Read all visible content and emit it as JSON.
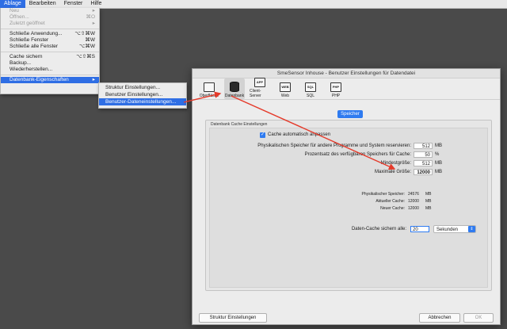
{
  "menubar": {
    "items": [
      "Ablage",
      "Bearbeiten",
      "Fenster",
      "Hilfe"
    ]
  },
  "file_menu": {
    "neu": "Neu",
    "oeffnen": "Öffnen...",
    "oeffnen_sc": "⌘O",
    "zuletzt": "Zuletzt geöffnet",
    "schliesse_anwendung": "Schließe Anwendung...",
    "schliesse_anwendung_sc": "⌥⇧⌘W",
    "schliesse_fenster": "Schließe Fenster",
    "schliesse_fenster_sc": "⌘W",
    "schliesse_alle": "Schließe alle Fenster",
    "schliesse_alle_sc": "⌥⌘W",
    "cache_sichern": "Cache sichern",
    "cache_sichern_sc": "⌥⇧⌘S",
    "backup": "Backup...",
    "wiederherstellen": "Wiederherstellen...",
    "datenbank": "Datenbank-Eigenschaften"
  },
  "submenu": {
    "items": [
      "Struktur Einstellungen...",
      "Benutzer Einstellungen...",
      "Benutzer-Dateneinstellungen..."
    ]
  },
  "dialog": {
    "title": "SmeSensor Inhouse - Benutzer Einstellungen für Datendatei",
    "toolbar": [
      "Oberfläche",
      "Datenbank",
      "Client-Server",
      "Web",
      "SQL",
      "PHP"
    ],
    "toolbar_icons": [
      "",
      "",
      "APP",
      "WEB",
      "SQL",
      "PHP"
    ],
    "tab": "Speicher",
    "group_title": "Datenbank Cache Einstellungen",
    "auto_cache_label": "Cache automatisch anpassen",
    "reserve_label": "Physikalischen Speicher für andere Programme und System reservieren:",
    "reserve_value": "512",
    "percent_label": "Prozentsatz des verfügbaren Speichers für Cache:",
    "percent_value": "50",
    "min_label": "Mindestgröße:",
    "min_value": "512",
    "max_label": "Maximale Größe:",
    "max_value": "12000",
    "unit_mb": "MB",
    "unit_percent": "%",
    "phys_label": "Physikalischer Speicher:",
    "phys_value": "24576",
    "aktuell_label": "Aktueller Cache:",
    "aktuell_value": "12000",
    "neuer_label": "Neuer Cache:",
    "neuer_value": "12000",
    "save_label": "Daten-Cache sichern alle:",
    "save_value": "20",
    "save_unit": "Sekunden",
    "btn_struktur": "Struktur Einstellungen",
    "btn_abbrechen": "Abbrechen",
    "btn_ok": "OK"
  },
  "colors": {
    "accent": "#2f6ee4",
    "annotation": "#e53a2a"
  }
}
